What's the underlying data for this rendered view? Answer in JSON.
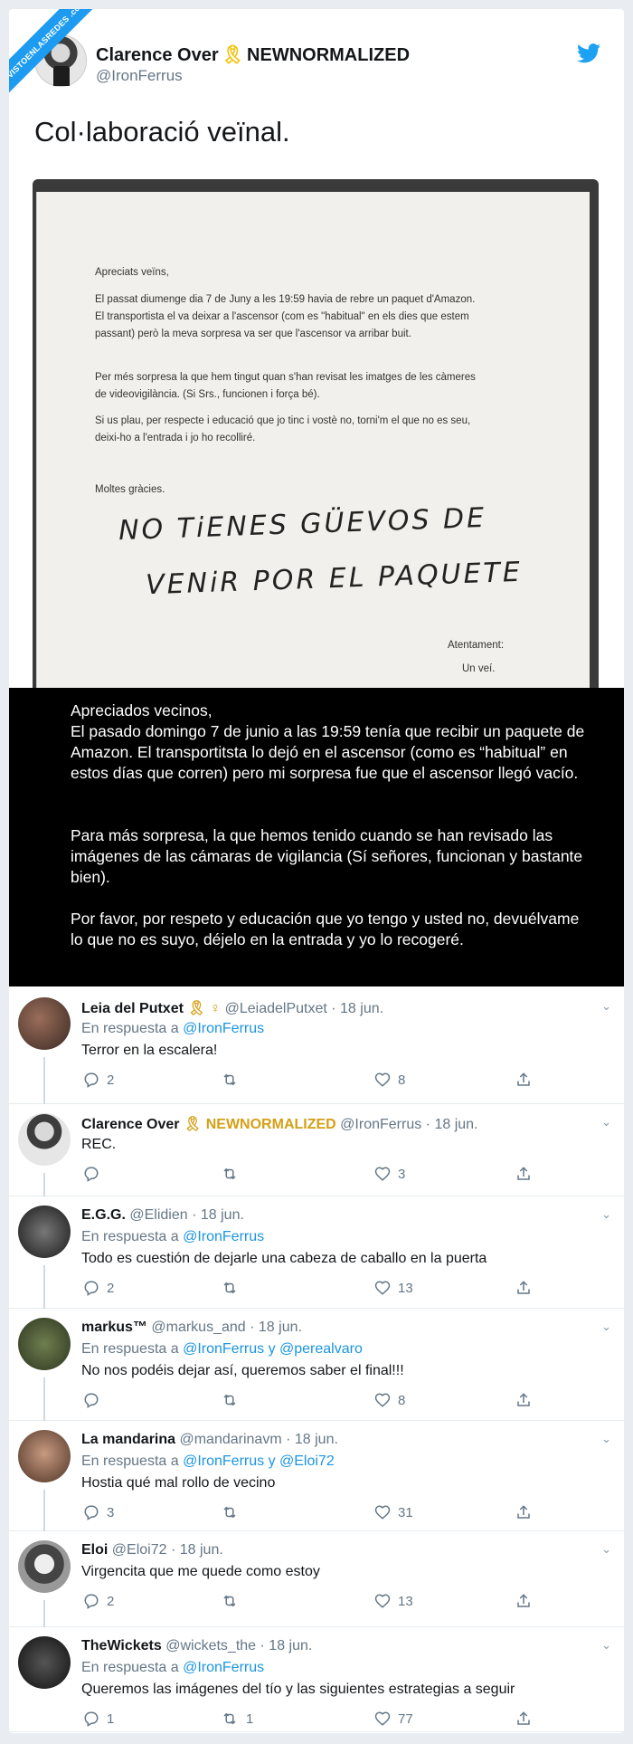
{
  "watermark": "VISTOENLASREDES .com",
  "main": {
    "name": "Clarence Over",
    "ribbon": "🎗",
    "name_suffix": "NEWNORMALIZED",
    "handle": "@IronFerrus",
    "text": "Col·laboració veïnal."
  },
  "note": {
    "greeting": "Apreciats veïns,",
    "p1": "El passat diumenge dia 7 de Juny a les 19:59 havia de rebre un paquet d'Amazon. El transportista el va deixar a l'ascensor (com es \"habitual\" en els dies que estem passant) però la meva sorpresa va ser que l'ascensor va arribar buit.",
    "p2": "Per més sorpresa la que hem tingut quan s'han revisat les imatges de les càmeres de videovigilància. (Si Srs., funcionen i força bé).",
    "p3": "Si us plau, per respecte i educació que jo tinc i vostè no, torni'm el que no es seu, deixi-ho a l'entrada i jo ho recolliré.",
    "thanks": "Moltes gràcies.",
    "hand1": "NO TiENES GÜEVOS DE",
    "hand2": "VENiR POR EL PAQUETE",
    "closing": "Atentament:",
    "sign": "Un veí."
  },
  "translation": {
    "p1": "Apreciados vecinos,\nEl pasado domingo 7 de junio a las 19:59 tenía que recibir un paquete de Amazon. El transportitsta lo dejó en el ascensor (como es “habitual” en estos días que corren) pero mi sorpresa fue que el ascensor llegó vacío.",
    "p2": "Para más sorpresa, la que hemos tenido cuando se han revisado las imágenes de las cámaras de vigilancia (Sí señores, funcionan y bastante bien).",
    "p3": "Por favor, por respeto y educación que yo tengo y usted no, devuélvame lo que no es suyo, déjelo en la entrada y yo lo recogeré."
  },
  "colors": {
    "link": "#1b95e0",
    "brand": "#1da1f2",
    "muted": "#657786"
  },
  "replies": [
    {
      "name": "Leia del Putxet",
      "badges": "🎗 ♀",
      "handle": "@LeiadelPutxet",
      "date": "· 18 jun.",
      "in_reply": "En respuesta a ",
      "reply_to": "@IronFerrus",
      "text": "Terror en la escalera!",
      "replies": "2",
      "retweets": "",
      "likes": "8"
    },
    {
      "name": "Clarence Over",
      "badges": "🎗 NEWNORMALIZED",
      "handle": "@IronFerrus",
      "date": "· 18 jun.",
      "in_reply": "",
      "reply_to": "",
      "text": "REC.",
      "replies": "",
      "retweets": "",
      "likes": "3"
    },
    {
      "name": "E.G.G.",
      "badges": "",
      "handle": "@Elidien",
      "date": "· 18 jun.",
      "in_reply": "En respuesta a ",
      "reply_to": "@IronFerrus",
      "text": "Todo es cuestión de dejarle una cabeza de caballo en la puerta",
      "replies": "2",
      "retweets": "",
      "likes": "13"
    },
    {
      "name": "markus™",
      "badges": "",
      "handle": "@markus_and",
      "date": "· 18 jun.",
      "in_reply": "En respuesta a ",
      "reply_to": "@IronFerrus y @perealvaro",
      "text": "No nos podéis dejar así, queremos saber el final!!!",
      "replies": "",
      "retweets": "",
      "likes": "8"
    },
    {
      "name": "La mandarina",
      "badges": "",
      "handle": "@mandarinavm",
      "date": "· 18 jun.",
      "in_reply": "En respuesta a ",
      "reply_to": "@IronFerrus y @Eloi72",
      "text": "Hostia qué mal rollo de vecino",
      "replies": "3",
      "retweets": "",
      "likes": "31"
    },
    {
      "name": "Eloi",
      "badges": "",
      "handle": "@Eloi72",
      "date": "· 18 jun.",
      "in_reply": "",
      "reply_to": "",
      "text": "Virgencita que me quede como estoy",
      "replies": "2",
      "retweets": "",
      "likes": "13"
    },
    {
      "name": "TheWickets",
      "badges": "",
      "handle": "@wickets_the",
      "date": "· 18 jun.",
      "in_reply": "En respuesta a ",
      "reply_to": "@IronFerrus",
      "text": "Queremos las imágenes del tío y las siguientes estrategias a seguir",
      "replies": "1",
      "retweets": "1",
      "likes": "77"
    }
  ]
}
